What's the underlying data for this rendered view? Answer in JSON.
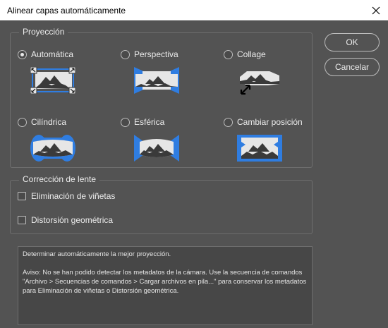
{
  "window": {
    "title": "Alinear capas automáticamente"
  },
  "projection": {
    "legend": "Proyección",
    "options": [
      {
        "label": "Automática",
        "selected": true,
        "icon": "auto-projection-icon"
      },
      {
        "label": "Perspectiva",
        "selected": false,
        "icon": "perspective-projection-icon"
      },
      {
        "label": "Collage",
        "selected": false,
        "icon": "collage-projection-icon"
      },
      {
        "label": "Cilíndrica",
        "selected": false,
        "icon": "cylindrical-projection-icon"
      },
      {
        "label": "Esférica",
        "selected": false,
        "icon": "spherical-projection-icon"
      },
      {
        "label": "Cambiar posición",
        "selected": false,
        "icon": "reposition-projection-icon"
      }
    ]
  },
  "lens": {
    "legend": "Corrección de lente",
    "options": [
      {
        "label": "Eliminación de viñetas",
        "checked": false
      },
      {
        "label": "Distorsión geométrica",
        "checked": false
      }
    ]
  },
  "buttons": {
    "ok": "OK",
    "cancel": "Cancelar"
  },
  "info": {
    "line1": "Determinar automáticamente la mejor proyección.",
    "line2": "Aviso: No se han podido detectar los metadatos de la cámara. Use la secuencia de comandos \"Archivo > Secuencias de comandos > Cargar archivos en pila...\" para conservar los metadatos para Eliminación de viñetas o Distorsión geométrica."
  },
  "colors": {
    "accent": "#2f7de1",
    "panel": "#535353",
    "icon_fill": "#e6e6e6"
  }
}
